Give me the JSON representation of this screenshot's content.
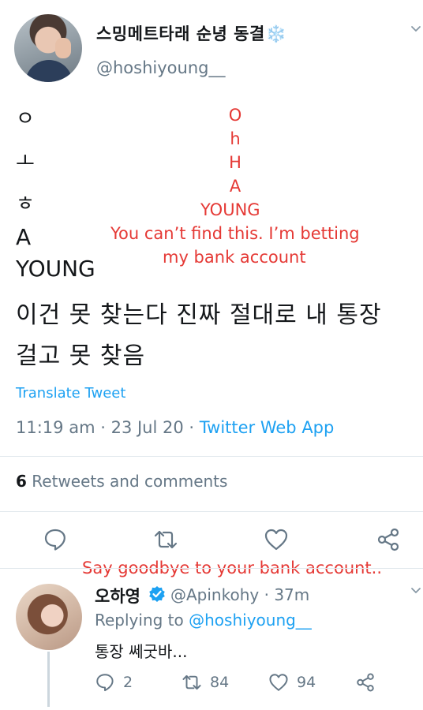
{
  "tweet": {
    "display_name": "스밍메트타래 순녕 동결",
    "name_emoji": "❄️",
    "handle": "@hoshiyoung__",
    "body_lines": [
      "ㅇ",
      "ㅗ",
      "ㅎ",
      "A",
      "YOUNG",
      "이건 못 찾는다 진짜 절대로 내 통장",
      "걸고 못 찾음"
    ],
    "translate_label": "Translate Tweet",
    "time": "11:19 am",
    "date": "23 Jul 20",
    "source": "Twitter Web App",
    "sep": "·",
    "retweets_count": "6",
    "retweets_label": "Retweets and comments"
  },
  "annotations": {
    "letters": [
      "O",
      "h",
      "H",
      "A"
    ],
    "young": "YOUNG",
    "line1": "You can’t find this. I’m betting",
    "line2": "my bank account",
    "goodbye": "Say goodbye to your bank account.."
  },
  "reply": {
    "display_name": "오하영",
    "handle": "@Apinkohy",
    "age": "37m",
    "replying_prefix": "Replying to",
    "replying_handle": "@hoshiyoung__",
    "text": "통장 쎄굿바...",
    "reply_count": "2",
    "retweet_count": "84",
    "like_count": "94"
  },
  "colors": {
    "accent": "#1da1f2",
    "annotation": "#e53935",
    "muted": "#657786",
    "divider": "#e1e8ed"
  },
  "icons": [
    "reply-icon",
    "retweet-icon",
    "like-icon",
    "share-icon",
    "chevron-down-icon",
    "verified-badge-icon",
    "snowflake-icon"
  ]
}
